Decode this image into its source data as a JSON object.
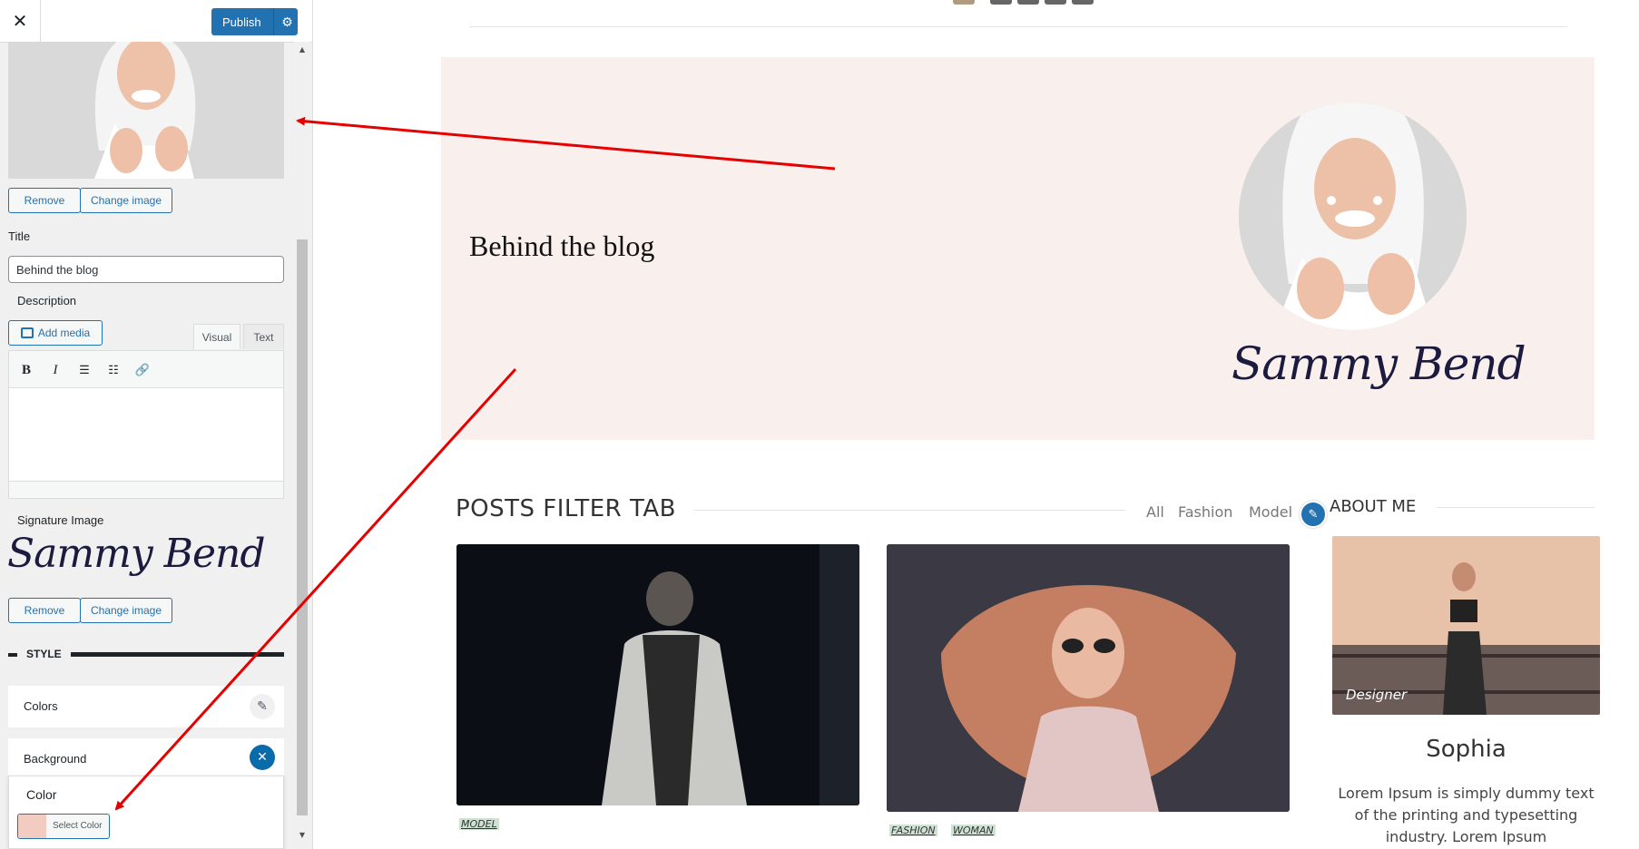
{
  "customizer": {
    "close_label": "✕",
    "publish_label": "Publish",
    "gear_icon": "⚙",
    "remove_label": "Remove",
    "change_image_label": "Change image",
    "title_label": "Title",
    "title_value": "Behind the blog",
    "description_label": "Description",
    "add_media_label": "Add media",
    "tab_visual": "Visual",
    "tab_text": "Text",
    "toolbar": {
      "bold": "B",
      "italic": "I",
      "bullets": "☰",
      "numbered": "☷",
      "link": "🔗"
    },
    "signature_label": "Signature Image",
    "signature_text": "Sammy Bend",
    "style_label": "STYLE",
    "colors_label": "Colors",
    "background_label": "Background",
    "color_label": "Color",
    "select_color_label": "Select Color",
    "color_swatch": "#f2cbc1"
  },
  "preview": {
    "slider_dots": [
      "#b09a80",
      "#666666",
      "#666666",
      "#666666",
      "#666666"
    ],
    "about_band_color": "#f9f0ed",
    "about_title": "Behind the blog",
    "about_signature": "Sammy Bend",
    "posts_title": "POSTS FILTER TAB",
    "filter_tabs": [
      "All",
      "Fashion",
      "Model"
    ],
    "about_me_heading": "ABOUT ME",
    "post1_categories": [
      "MODEL"
    ],
    "post2_categories": [
      "FASHION",
      "WOMAN"
    ],
    "sidebar_photo_caption": "Designer",
    "author_name": "Sophia",
    "author_bio": "Lorem Ipsum is simply dummy text of the printing and typesetting industry. Lorem Ipsum"
  },
  "colors": {
    "accent": "#2271b1",
    "annotation_arrow": "#e60000"
  }
}
